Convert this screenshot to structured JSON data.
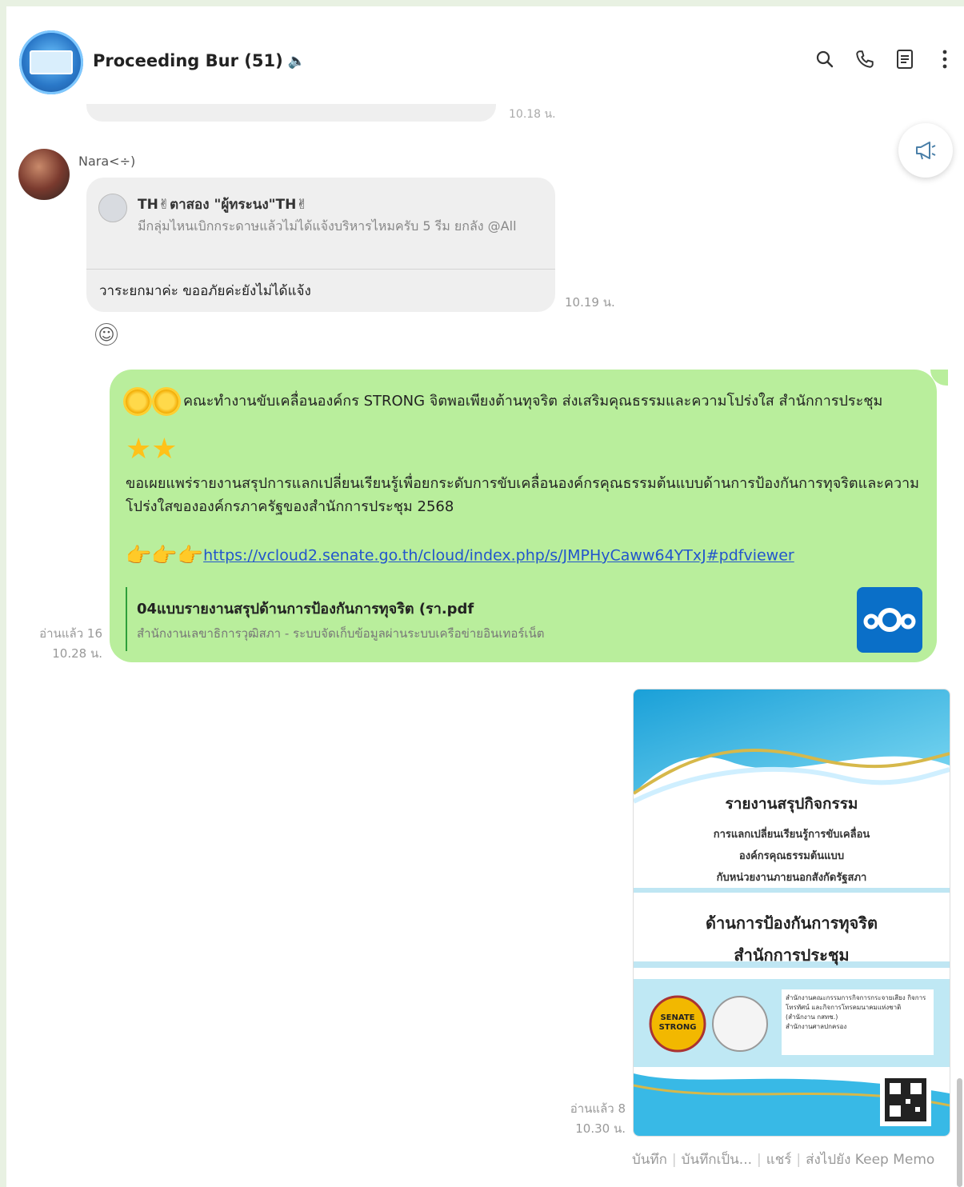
{
  "header": {
    "title": "Proceeding Bur (51)"
  },
  "prev_message": {
    "time": "10.18 น."
  },
  "incoming": {
    "sender": "Nara<÷)",
    "quote_name": "TH✌ตาสอง \"ผู้ทระนง\"TH✌",
    "quote_text": "มีกลุ่มไหนเบิกกระดาษแล้วไม่ได้แจ้งบริหารไหมครับ 5 รีม ยกลัง @All",
    "reply_text": "วาระยกมาค่ะ ขออภัยค่ะยังไม่ได้แจ้ง",
    "time": "10.19 น."
  },
  "outgoing": {
    "line1": "คณะทำงานขับเคลื่อนองค์กร STRONG จิตพอเพียงต้านทุจริต ส่งเสริมคุณธรรมและความโปร่งใส สำนักการประชุม",
    "line2": "ขอเผยแพร่รายงานสรุปการแลกเปลี่ยนเรียนรู้เพื่อยกระดับการขับเคลื่อนองค์กรคุณธรรมต้นแบบด้านการป้องกันการทุจริตและความโปร่งใสขององค์กรภาครัฐของสำนักการประชุม 2568",
    "link": "https://vcloud2.senate.go.th/cloud/index.php/s/JMPHyCaww64YTxJ#pdfviewer",
    "preview_title": "04แบบรายงานสรุปด้านการป้องกันการทุจริต (รา.pdf",
    "preview_sub": "สำนักงานเลขาธิการวุฒิสภา - ระบบจัดเก็บข้อมูลผ่านระบบเครือข่ายอินเทอร์เน็ต",
    "read": "อ่านแล้ว 16",
    "time": "10.28 น."
  },
  "image_message": {
    "doc_title": "รายงานสรุปกิจกรรม",
    "doc_sub1": "การแลกเปลี่ยนเรียนรู้การขับเคลื่อน",
    "doc_sub2": "องค์กรคุณธรรมต้นแบบ",
    "doc_sub3": "กับหน่วยงานภายนอกสังกัดรัฐสภา",
    "doc_main1": "ด้านการป้องกันการทุจริต",
    "doc_main2": "สำนักการประชุม",
    "logo_text": "SENATE STRONG",
    "box_text1": "สำนักงานคณะกรรมการกิจการกระจายเสียง กิจการโทรทัศน์ และกิจการโทรคมนาคมแห่งชาติ (สำนักงาน กสทช.)",
    "box_text2": "สำนักงานศาลปกครอง",
    "read": "อ่านแล้ว 8",
    "time": "10.30 น.",
    "actions": [
      "บันทึก",
      "บันทึกเป็น...",
      "แชร์",
      "ส่งไปยัง Keep Memo"
    ]
  },
  "colors": {
    "out_bubble": "#b9ee9c",
    "in_bubble": "#efefef",
    "link": "#2255cc"
  }
}
